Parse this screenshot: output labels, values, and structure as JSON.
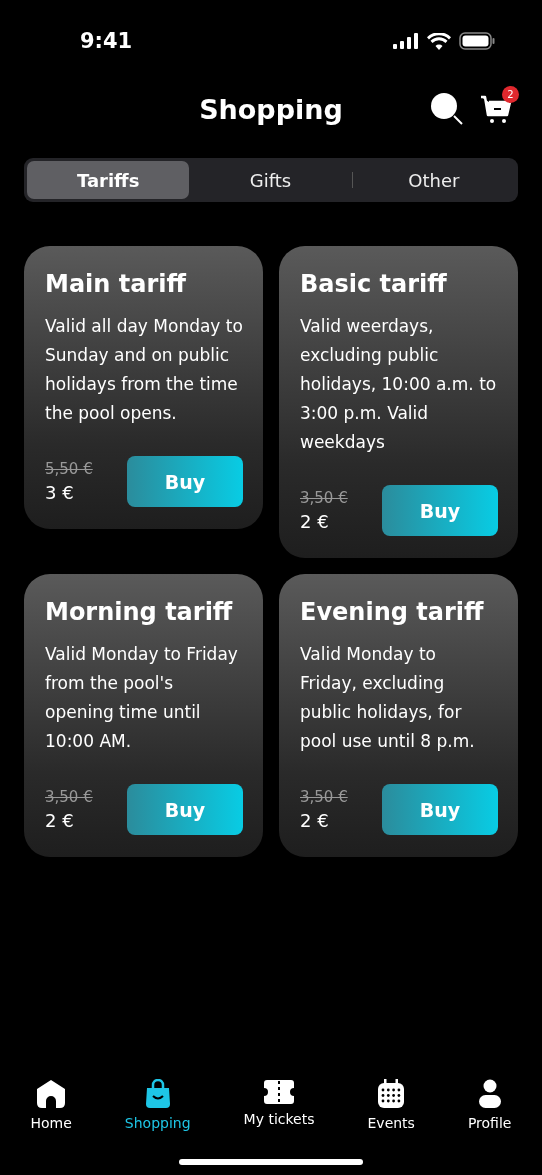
{
  "status_bar": {
    "time": "9:41"
  },
  "header": {
    "title": "Shopping",
    "cart_count": "2"
  },
  "tabs": [
    {
      "label": "Tariffs",
      "selected": true
    },
    {
      "label": "Gifts",
      "selected": false
    },
    {
      "label": "Other",
      "selected": false
    }
  ],
  "tariffs": [
    {
      "name": "Main tariff",
      "description": "Valid all day Monday to Sunday and on public holidays from the time the pool opens.",
      "old_price": "5,50 €",
      "price": "3 €",
      "button": "Buy"
    },
    {
      "name": "Basic tariff",
      "description": "Valid weerdays, excluding public holidays, 10:00 a.m. to 3:00 p.m. Valid weekdays",
      "old_price": "3,50 €",
      "price": "2 €",
      "button": "Buy"
    },
    {
      "name": "Morning tariff",
      "description": "Valid Monday to Friday from the pool's opening time until 10:00 AM.",
      "old_price": "3,50 €",
      "price": "2 €",
      "button": "Buy"
    },
    {
      "name": "Evening tariff",
      "description": "Valid Monday to Friday, excluding public holidays, for pool use until 8 p.m.",
      "old_price": "3,50 €",
      "price": "2 €",
      "button": "Buy"
    }
  ],
  "nav": [
    {
      "label": "Home",
      "kind": "home",
      "selected": false
    },
    {
      "label": "Shopping",
      "kind": "shopping",
      "selected": true
    },
    {
      "label": "My tickets",
      "kind": "tickets",
      "selected": false
    },
    {
      "label": "Events",
      "kind": "events",
      "selected": false
    },
    {
      "label": "Profile",
      "kind": "profile",
      "selected": false
    }
  ]
}
